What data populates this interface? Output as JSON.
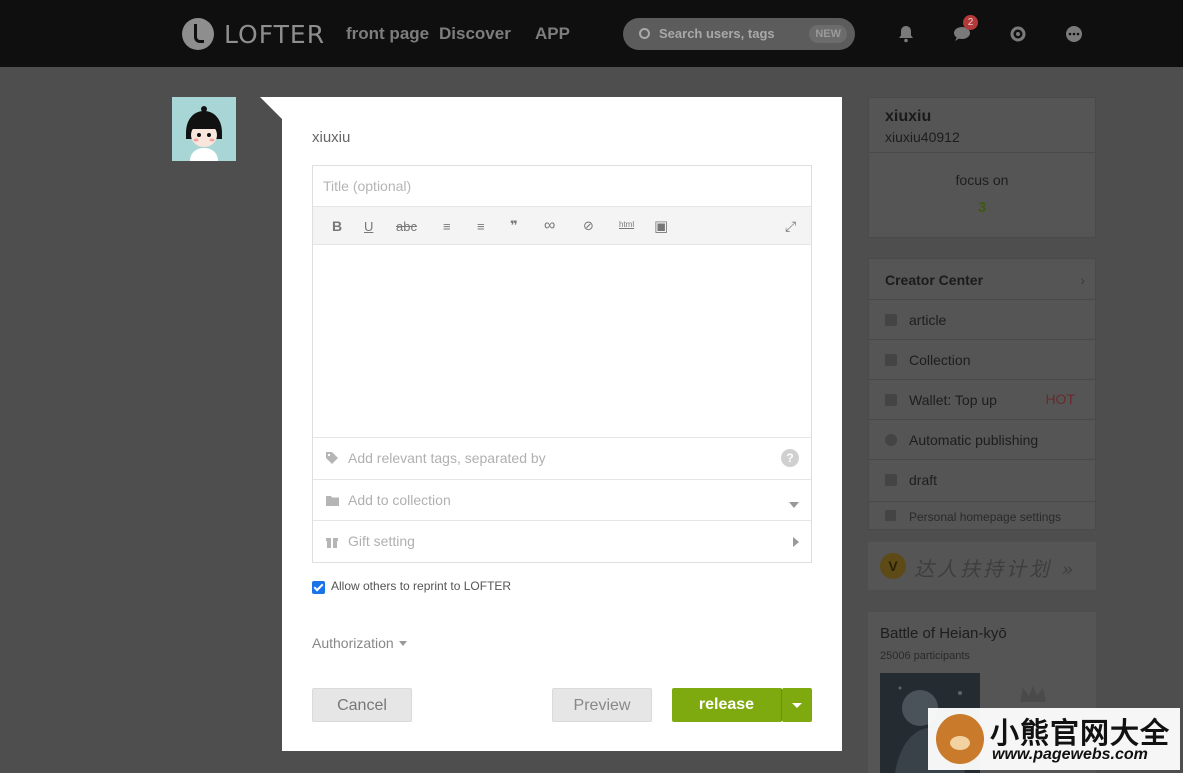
{
  "topbar": {
    "logo_text": "LOFTER",
    "nav": [
      "front page",
      "Discover",
      "APP"
    ],
    "search_placeholder": "Search users, tags",
    "search_badge": "NEW",
    "message_count": "2",
    "icons": [
      "bell-icon",
      "chat-icon",
      "gear-icon",
      "more-icon"
    ]
  },
  "composer": {
    "username": "xiuxiu",
    "title_placeholder": "Title (optional)",
    "toolbar_icons": [
      "B",
      "U",
      "abc",
      "≡",
      "≡",
      "❞",
      "∞",
      "⊘",
      "html",
      "▣",
      "⤢"
    ],
    "tags_placeholder": "Add relevant tags, separated by",
    "collection_label": "Add to collection",
    "gift_label": "Gift setting",
    "reprint_label": "Allow others to reprint to LOFTER",
    "reprint_checked": true,
    "authorization_label": "Authorization",
    "cancel_label": "Cancel",
    "preview_label": "Preview",
    "release_label": "release"
  },
  "profile": {
    "name": "xiuxiu",
    "id": "xiuxiu40912",
    "focus_label": "focus on",
    "focus_count": "3"
  },
  "creator_center": {
    "title": "Creator Center",
    "items": [
      {
        "label": "article",
        "badge": ""
      },
      {
        "label": "Collection",
        "badge": ""
      },
      {
        "label": "Wallet: Top up",
        "badge": "HOT"
      },
      {
        "label": "Automatic publishing",
        "badge": ""
      },
      {
        "label": "draft",
        "badge": ""
      }
    ],
    "settings_label": "Personal homepage settings"
  },
  "promo": {
    "badge": "V",
    "text": "达人扶持计划 »"
  },
  "event": {
    "title": "Battle of Heian-kyō",
    "participants": "25006 participants"
  },
  "watermark": {
    "title": "小熊官网大全",
    "url": "www.pagewebs.com"
  },
  "colors": {
    "accent_green": "#7eaa10",
    "topbar_bg": "#0f0f0f",
    "overlay_bg": "#4e4e4e"
  }
}
